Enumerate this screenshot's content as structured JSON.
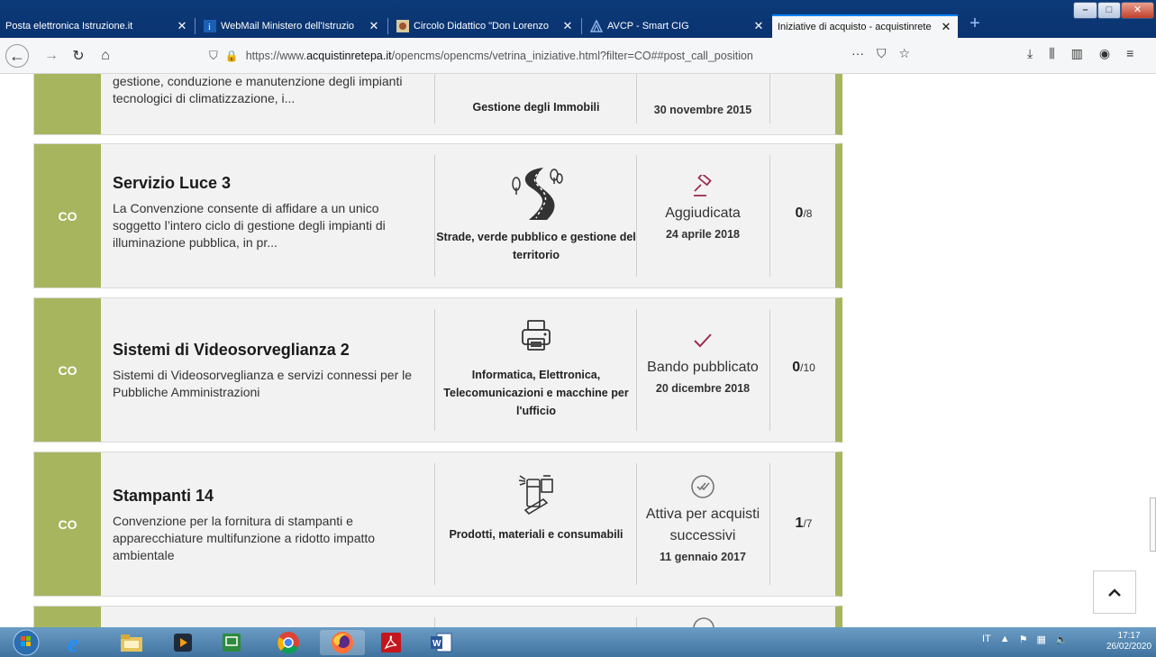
{
  "browser": {
    "tabs": [
      {
        "title": "Posta elettronica Istruzione.it",
        "active": false
      },
      {
        "title": "WebMail Ministero dell'Istruzio",
        "active": false
      },
      {
        "title": "Circolo Didattico \"Don Lorenzo",
        "active": false
      },
      {
        "title": "AVCP - Smart CIG",
        "active": false
      },
      {
        "title": "Iniziative di acquisto - acquistinrete",
        "active": true
      }
    ],
    "url_prefix": "https://www.",
    "url_host": "acquistinretepa.it",
    "url_path": "/opencms/opencms/vetrina_iniziative.html?filter=CO##post_call_position",
    "url_more": "···"
  },
  "cards": [
    {
      "type": "CO",
      "title": "",
      "description": "gestione, conduzione e manutenzione degli impianti tecnologici di climatizzazione, i...",
      "category": "Gestione degli Immobili",
      "status": "",
      "date": "30 novembre 2015",
      "count_done": "",
      "count_total": ""
    },
    {
      "type": "CO",
      "title": "Servizio Luce 3",
      "description": "La Convenzione consente di affidare a un unico soggetto l’intero ciclo di gestione degli impianti di illuminazione pubblica, in pr...",
      "category": "Strade, verde pubblico e gestione del territorio",
      "status": "Aggiudicata",
      "date": "24 aprile 2018",
      "count_done": "0",
      "count_total": "/8"
    },
    {
      "type": "CO",
      "title": "Sistemi di Videosorveglianza 2",
      "description": "Sistemi di Videosorveglianza e servizi connessi per le Pubbliche Amministrazioni",
      "category": "Informatica, Elettronica, Telecomunicazioni e macchine per l'ufficio",
      "status": "Bando pubblicato",
      "date": "20 dicembre 2018",
      "count_done": "0",
      "count_total": "/10"
    },
    {
      "type": "CO",
      "title": "Stampanti 14",
      "description": "Convenzione per la fornitura di stampanti e apparecchiature multifunzione a ridotto impatto ambientale",
      "category": "Prodotti, materiali e consumabili",
      "status": "Attiva per acquisti successivi",
      "date": "11 gennaio 2017",
      "count_done": "1",
      "count_total": "/7"
    }
  ],
  "taskbar": {
    "lang": "IT",
    "time": "17:17",
    "date": "26/02/2020"
  },
  "colors": {
    "accent_green": "#a7b55f",
    "status_icon": "#9b2d4f"
  }
}
